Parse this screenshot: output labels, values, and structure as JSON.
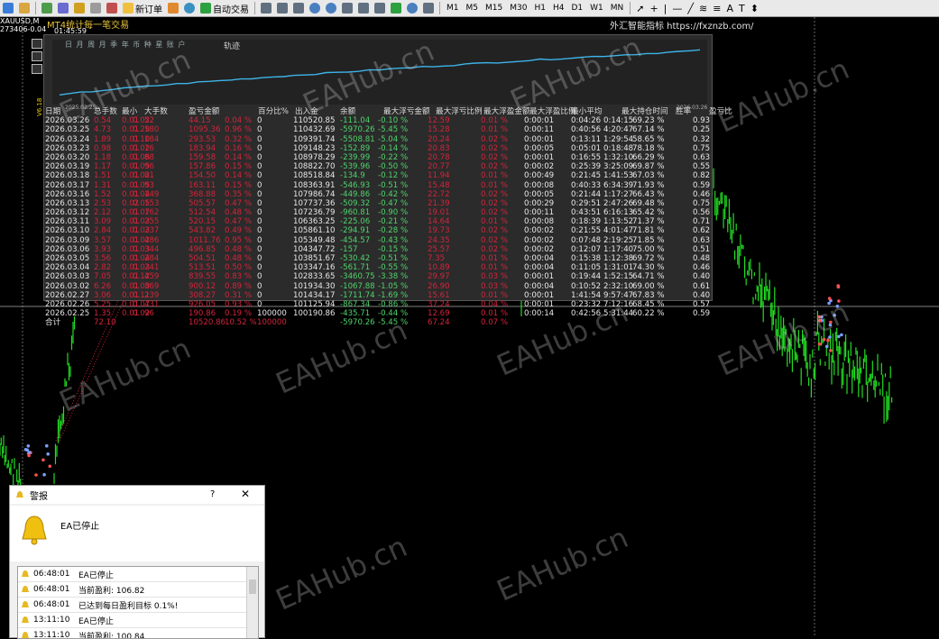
{
  "toolbar": {
    "buttons": [
      {
        "name": "new-chart",
        "label": ""
      },
      {
        "name": "profiles",
        "label": ""
      },
      {
        "name": "market-watch",
        "label": ""
      },
      {
        "name": "data-window",
        "label": ""
      },
      {
        "name": "navigator",
        "label": ""
      },
      {
        "name": "terminal",
        "label": ""
      },
      {
        "name": "strategy-tester",
        "label": ""
      }
    ],
    "new_order_label": "新订单",
    "auto_trade_label": "自动交易",
    "timeframes": [
      "M1",
      "M5",
      "M15",
      "M30",
      "H1",
      "H4",
      "D1",
      "W1",
      "MN"
    ]
  },
  "chart": {
    "symbol": "XAUUSD,M",
    "symbol_value": "273406-0.04",
    "ea_title": "MT4统计每一笔交易",
    "ea_time": "01:45:59",
    "brand_text": "外汇智能指标 https://fxznzb.com/"
  },
  "panel": {
    "tabs": "日 月 周 月 季 年 币 种 星 账 户",
    "legend": "轨迹",
    "equity_start_date": "2025.02.25",
    "equity_end_date": "2026.03.26",
    "version": "V6.18",
    "headers": [
      "日期",
      "总手数",
      "最小",
      "大手数",
      "盈亏金额",
      "百分比%",
      "出入金",
      "余额",
      "最大浮亏金额",
      "最大浮亏比例",
      "最大浮盈金额",
      "最大浮盈比例",
      "最小平均",
      "最大持仓时间",
      "胜率",
      "盈亏比"
    ],
    "rows": [
      [
        "2026.03.26",
        "0.54",
        "0.01",
        "0.02",
        "52",
        "44.15",
        "0.04 %",
        "0",
        "110520.85",
        "-111.04",
        "-0.10 %",
        "12.59",
        "0.01 %",
        "0:00:01",
        "0:04:26",
        "0:14:15",
        "69.23 %",
        "0.93"
      ],
      [
        "2026.03.25",
        "4.73",
        "0.01",
        "0.29",
        "180",
        "1095.36",
        "0.96 %",
        "0",
        "110432.69",
        "-5970.26",
        "-5.45 %",
        "15.28",
        "0.01 %",
        "0:00:11",
        "0:40:56",
        "4:20:47",
        "67.14 %",
        "0.25"
      ],
      [
        "2026.03.24",
        "1.89",
        "0.01",
        "0.10",
        "184",
        "293.53",
        "0.32 %",
        "0",
        "109391.74",
        "-5508.81",
        "-5.04 %",
        "20.24",
        "0.02 %",
        "0:00:01",
        "0:13:11",
        "1:29:54",
        "58.65 %",
        "0.32"
      ],
      [
        "2026.03.23",
        "0.98",
        "0.01",
        "0.02",
        "16",
        "183.94",
        "0.16 %",
        "0",
        "109148.23",
        "-152.89",
        "-0.14 %",
        "20.83",
        "0.02 %",
        "0:00:05",
        "0:05:01",
        "0:18:48",
        "78.18 %",
        "0.75"
      ],
      [
        "2026.03.20",
        "1.18",
        "0.01",
        "0.06",
        "88",
        "159.58",
        "0.14 %",
        "0",
        "108978.29",
        "-239.99",
        "-0.22 %",
        "20.78",
        "0.02 %",
        "0:00:01",
        "0:16:55",
        "1:32:10",
        "66.29 %",
        "0.63"
      ],
      [
        "2026.03.19",
        "1.17",
        "0.01",
        "0.05",
        "96",
        "157.86",
        "0.15 %",
        "0",
        "108822.70",
        "-539.96",
        "-0.50 %",
        "20.77",
        "0.02 %",
        "0:00:02",
        "0:25:39",
        "3:25:09",
        "69.87 %",
        "0.55"
      ],
      [
        "2026.03.18",
        "1.51",
        "0.01",
        "0.02",
        "81",
        "154.50",
        "0.14 %",
        "0",
        "108518.84",
        "-134.9",
        "-0.12 %",
        "11.94",
        "0.01 %",
        "0:00:49",
        "0:21:45",
        "1:41:53",
        "67.03 %",
        "0.82"
      ],
      [
        "2026.03.17",
        "1.31",
        "0.01",
        "0.05",
        "93",
        "163.11",
        "0.15 %",
        "0",
        "108363.91",
        "-546.93",
        "-0.51 %",
        "15.48",
        "0.01 %",
        "0:00:08",
        "0:40:33",
        "6:34:39",
        "71.93 %",
        "0.59"
      ],
      [
        "2026.03.16",
        "1.52",
        "0.01",
        "0.04",
        "149",
        "368.88",
        "0.35 %",
        "0",
        "107986.74",
        "-449.86",
        "-0.42 %",
        "22.72",
        "0.02 %",
        "0:00:05",
        "0:21:44",
        "1:17:27",
        "66.43 %",
        "0.46"
      ],
      [
        "2026.03.13",
        "2.53",
        "0.02",
        "0.05",
        "153",
        "505.57",
        "0.47 %",
        "0",
        "107737.36",
        "-509.32",
        "-0.47 %",
        "21.39",
        "0.02 %",
        "0:00:29",
        "0:29:51",
        "2:47:26",
        "69.48 %",
        "0.75"
      ],
      [
        "2026.03.12",
        "2.12",
        "0.01",
        "0.07",
        "162",
        "512.54",
        "0.48 %",
        "0",
        "107236.79",
        "-960.81",
        "-0.90 %",
        "19.01",
        "0.02 %",
        "0:00:11",
        "0:43:51",
        "6:16:13",
        "65.42 %",
        "0.56"
      ],
      [
        "2026.03.11",
        "3.09",
        "0.01",
        "0.03",
        "255",
        "520.15",
        "0.47 %",
        "0",
        "106363.25",
        "-225.06",
        "-0.21 %",
        "14.64",
        "0.01 %",
        "0:00:08",
        "0:18:39",
        "1:13:52",
        "71.37 %",
        "0.71"
      ],
      [
        "2026.03.10",
        "2.84",
        "0.01",
        "0.03",
        "237",
        "543.82",
        "0.49 %",
        "0",
        "105861.10",
        "-294.91",
        "-0.28 %",
        "19.73",
        "0.02 %",
        "0:00:02",
        "0:21:55",
        "4:01:47",
        "71.81 %",
        "0.62"
      ],
      [
        "2026.03.09",
        "3.57",
        "0.01",
        "0.02",
        "486",
        "1011.76",
        "0.95 %",
        "0",
        "105349.48",
        "-454.57",
        "-0.43 %",
        "24.35",
        "0.02 %",
        "0:00:02",
        "0:07:48",
        "2:19:25",
        "71.85 %",
        "0.63"
      ],
      [
        "2026.03.06",
        "3.93",
        "0.01",
        "0.03",
        "344",
        "496.85",
        "0.48 %",
        "0",
        "104347.72",
        "-157",
        "-0.15 %",
        "25.57",
        "0.02 %",
        "0:00:02",
        "0:12:07",
        "1:17:40",
        "75.00 %",
        "0.51"
      ],
      [
        "2026.03.05",
        "3.56",
        "0.01",
        "0.04",
        "284",
        "504.51",
        "0.48 %",
        "0",
        "103851.67",
        "-530.42",
        "-0.51 %",
        "7.35",
        "0.01 %",
        "0:00:04",
        "0:15:38",
        "1:12:38",
        "69.72 %",
        "0.48"
      ],
      [
        "2026.03.04",
        "2.82",
        "0.01",
        "0.03",
        "241",
        "513.51",
        "0.50 %",
        "0",
        "103347.16",
        "-561.71",
        "-0.55 %",
        "10.89",
        "0.01 %",
        "0:00:04",
        "0:11:05",
        "1:31:01",
        "74.30 %",
        "0.46"
      ],
      [
        "2026.03.03",
        "7.05",
        "0.01",
        "0.12",
        "459",
        "839.55",
        "0.83 %",
        "0",
        "102833.65",
        "-3460.75",
        "-3.38 %",
        "29.97",
        "0.03 %",
        "0:00:01",
        "0:19:44",
        "1:52:15",
        "64.71 %",
        "0.40"
      ],
      [
        "2026.03.02",
        "6.26",
        "0.01",
        "0.08",
        "369",
        "900.12",
        "0.89 %",
        "0",
        "101934.30",
        "-1067.88",
        "-1.05 %",
        "26.90",
        "0.03 %",
        "0:00:04",
        "0:10:52",
        "2:32:10",
        "69.00 %",
        "0.61"
      ],
      [
        "2026.02.27",
        "3.06",
        "0.01",
        "0.11",
        "239",
        "308.27",
        "0.31 %",
        "0",
        "101434.17",
        "-1711.74",
        "-1.69 %",
        "15.61",
        "0.01 %",
        "0:00:01",
        "1:41:54",
        "9:57:47",
        "67.83 %",
        "0.40"
      ],
      [
        "2026.02.26",
        "5.25",
        "0.01",
        "0.07",
        "431",
        "926.05",
        "0.93 %",
        "0",
        "101125.94",
        "-867.34",
        "-0.86 %",
        "37.24",
        "0.04 %",
        "0:00:01",
        "0:23:32",
        "7:12:16",
        "68.45 %",
        "0.57"
      ],
      [
        "2026.02.25",
        "1.35",
        "0.01",
        "0.02",
        "96",
        "190.86",
        "0.19 %",
        "100000",
        "100190.86",
        "-435.71",
        "-0.44 %",
        "12.69",
        "0.01 %",
        "0:00:14",
        "0:42:56",
        "5:31:44",
        "60.22 %",
        "0.59"
      ]
    ],
    "total": [
      "合计",
      "72.10",
      "",
      "",
      "",
      "10520.86",
      "10.52 %",
      "100000",
      "",
      "-5970.26",
      "-5.45 %",
      "67.24",
      "0.07 %"
    ]
  },
  "alert": {
    "title": "警报",
    "help": "?",
    "close": "✕",
    "message": "EA已停止",
    "entries": [
      {
        "time": "06:48:01",
        "msg": "EA已停止"
      },
      {
        "time": "06:48:01",
        "msg": "当前盈利: 106.82"
      },
      {
        "time": "06:48:01",
        "msg": "已达到每日盈利目标 0.1%!"
      },
      {
        "time": "13:11:10",
        "msg": "EA已停止"
      },
      {
        "time": "13:11:10",
        "msg": "当前盈利: 100.84"
      }
    ]
  },
  "watermarks": [
    "EAHub.cn",
    "EAHub.cn",
    "EAHub.cn",
    "EAHub.cn",
    "EAHub.cn",
    "EAHub.cn",
    "EAHub.cn",
    "EAHub.cn",
    "EAHub.cn",
    "EAHub.cn",
    "EAHub.cn"
  ],
  "colors": {
    "up": "#22dd22",
    "down": "#d3243a",
    "equity": "#3db4e8",
    "background": "#000000"
  }
}
